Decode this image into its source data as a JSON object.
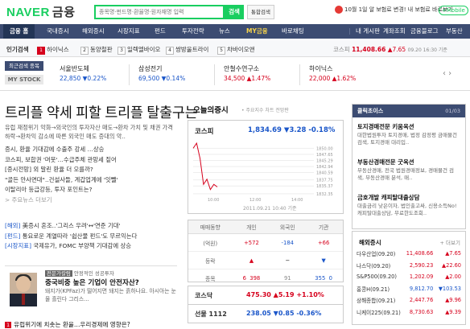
{
  "header": {
    "logo_naver": "NAVER",
    "logo_finance": "금융",
    "search_placeholder": "종목명·펀드명·환율명·원자재명 입력",
    "search_button": "검색",
    "total_search": "통합검색",
    "promo_text": "10월 1일 알 보험료 변경! 내 보험료 바로보기",
    "mobile": "+Mobile"
  },
  "nav": {
    "items": [
      "금융 홈",
      "국내증시",
      "해외증시",
      "시장지표",
      "펀드",
      "투자전략",
      "뉴스",
      "MY금융",
      "바로채팅"
    ],
    "right_items": [
      "내 게시판",
      "계좌조회",
      "금융블로그",
      "부동산"
    ]
  },
  "hotbar": {
    "label": "인기검색",
    "items": [
      "하이닉스",
      "동양철판",
      "일렉엘바이오",
      "쌍방울트라이",
      "차바이오앤"
    ],
    "kospi_label": "코스피",
    "kospi_value": "11,408.66",
    "kospi_change": "▲7.65",
    "kospi_time": "09.20 16:30 기준"
  },
  "recent": {
    "tag": "최근검색 종목",
    "mystock": "MY STOCK",
    "stocks": [
      {
        "name": "서울반도체",
        "value": "22,850 ▼0.22%"
      },
      {
        "name": "삼성전기",
        "value": "69,500 ▼0.14%"
      },
      {
        "name": "안철수연구소",
        "value": "34,500 ▲1.47%"
      },
      {
        "name": "하이닉스",
        "value": "22,000 ▲1.62%"
      }
    ]
  },
  "main": {
    "headline": "트리플 약세 피할 트리플 탈출구는",
    "lead": "유럽 재정위기 악화→외국인의 투자자산 매도→환차 가치 및 채권 가격 하락→환차익 감소에 따른 외국인 매도 증대의 악..",
    "lead_link": "> 주요뉴스 더보기",
    "news1": [
      "증시, 환율 기대감에 수출주 강세 …상승",
      "코스피, 보합권 '머뭇'…수급주체 관망세 짙어",
      "[증시전망] 외 말린 환율 더 오를까?",
      "\"골든 안사면대\"..건설사들, 계갑업계에 '잇뺄'",
      "이탈리아 등급강등, 투자 포인트는?"
    ],
    "news2": [
      {
        "tag": "[해외]",
        "text": " 美증시 혼조..'그리스 우려'↔'연준 기대'"
      },
      {
        "tag": "[펀드]",
        "text": " 통요로운 계열따라 '쉽산물 펀드'도 무르익는다"
      },
      {
        "tag": "[시장지표]",
        "text": " 국제유가, FOMC 부양책 기대감에 상승"
      }
    ],
    "opinion_tag_pill": "전문가칼럼",
    "opinion_tag_text": "안정적인 성공투자",
    "opinion_title": "중국비중 높은 기업이 안전자산?",
    "opinion_body": "돼지가(KPFaz)가 떨어지면 돼지는 흙하나요. 아시아는 눈물 흘린다 그리스...",
    "bottom_num": "1",
    "bottom_news": "유럽위기에 치솟는 환율…우리경제에 영향은?"
  },
  "center": {
    "title": "오늘의증시",
    "time": "• 주요지수 차트 전망판",
    "kospi_name": "코스피",
    "kospi_value": "1,834.69",
    "kospi_change": "▼3.28 -0.18%",
    "chart_date": "2011.09.21 10:40 기준",
    "invest_headers": [
      "매매동향",
      "개인",
      "외국인",
      "기관"
    ],
    "invest_rows": [
      {
        "label": "(억원)",
        "a": "+572",
        "b": "-184",
        "c": "+66"
      },
      {
        "label": "등락",
        "a": "▲",
        "b": "━",
        "c": "▼"
      },
      {
        "label": "종목",
        "a": "6",
        "b": "398",
        "c": "91",
        "d": "355",
        "e": "0"
      }
    ],
    "kosdaq_name": "코스닥",
    "kosdaq_value": "475.30",
    "kosdaq_change": "▲5.19 +1.10%",
    "futures_name": "선물 1112",
    "futures_value": "238.05",
    "futures_change": "▼0.85 -0.36%"
  },
  "right": {
    "click_title": "클릭초이스",
    "click_pager": "01/03",
    "ads": [
      {
        "title": "토지경매전문 키움옥션",
        "body": "대한법원투자 토지경매, 법정 감정평 금매물건 검색, 토지경매 대리입.."
      },
      {
        "title": "부동산경매전문 굿옥션",
        "body": "부동산경매, 전국 법원경매정보, 경매물건 검색, 부동산경매 분석, 매.."
      },
      {
        "title": "금호개발 캐피탈대출상담",
        "body": "대출금리 낮은이자, 법인출고싸, 신용소득No! 캐피탈대출상담, 무료한도조회.."
      }
    ],
    "overseas_title": "해외증시",
    "overseas_more": "+ 더보기",
    "overseas": [
      {
        "name": "다우산업(09.20)",
        "value": "11,408.66",
        "change": "▲7.65"
      },
      {
        "name": "나스닥(09.20)",
        "value": "2,590.23",
        "change": "▲22.60"
      },
      {
        "name": "S&P500(09.20)",
        "value": "1,202.09",
        "change": "▲2.00"
      },
      {
        "name": "홍콩H(09.21)",
        "value": "9,812.70",
        "change": "▼103.53"
      },
      {
        "name": "상해종합(09.21)",
        "value": "2,447.76",
        "change": "▲9.96"
      },
      {
        "name": "니케이225(09.21)",
        "value": "8,730.63",
        "change": "▲9.39"
      }
    ]
  },
  "chart_data": {
    "type": "line",
    "title": "코스피",
    "x": [
      "09:00",
      "09:15",
      "09:30",
      "09:45",
      "10:00",
      "10:15",
      "10:30",
      "10:40"
    ],
    "values": [
      1850,
      1852,
      1846,
      1836,
      1838,
      1834,
      1836,
      1835
    ],
    "yticks": [
      1850.0,
      1847.65,
      1845.29,
      1842.94,
      1840.59,
      1837.75,
      1835.37,
      1832.35
    ],
    "xticks": [
      "10:00",
      "12:00",
      "14:00"
    ],
    "ylim": [
      1832,
      1852
    ]
  },
  "colors": {
    "nav_bg": "#3c4c72",
    "accent_green": "#19ce60",
    "up": "#d6001c",
    "down": "#1a56c9"
  }
}
